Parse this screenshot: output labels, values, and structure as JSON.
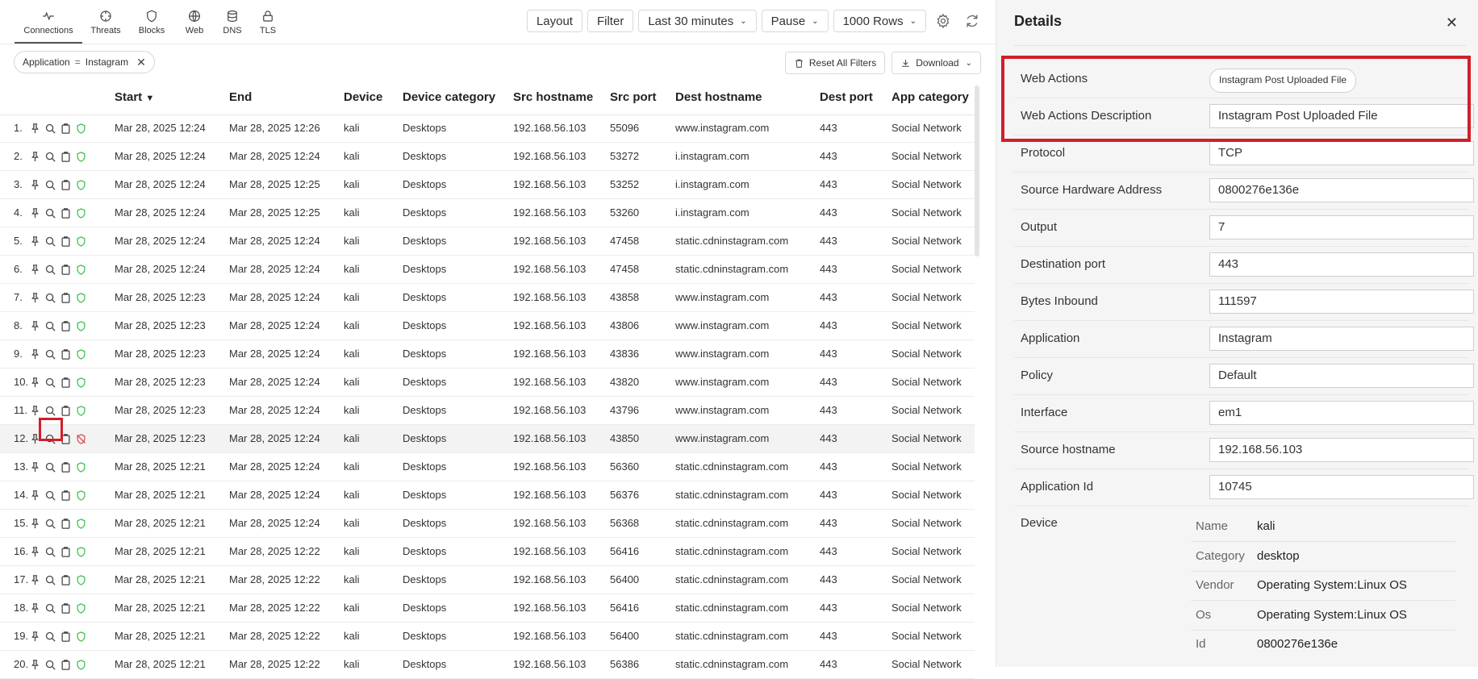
{
  "tabs": [
    {
      "label": "Connections",
      "icon": "pulse-icon"
    },
    {
      "label": "Threats",
      "icon": "crosshair-icon"
    },
    {
      "label": "Blocks",
      "icon": "shield-icon"
    },
    {
      "label": "Web",
      "icon": "globe-icon"
    },
    {
      "label": "DNS",
      "icon": "database-icon"
    },
    {
      "label": "TLS",
      "icon": "lock-icon"
    }
  ],
  "toolbar": {
    "layout": "Layout",
    "filter": "Filter",
    "range": "Last 30 minutes",
    "pause": "Pause",
    "rows": "1000 Rows"
  },
  "filter_chip": {
    "field": "Application",
    "op": "=",
    "value": "Instagram"
  },
  "actions": {
    "reset": "Reset All Filters",
    "download": "Download"
  },
  "columns": [
    "Start",
    "End",
    "Device",
    "Device category",
    "Src hostname",
    "Src port",
    "Dest hostname",
    "Dest port",
    "App category"
  ],
  "rows": [
    {
      "n": "1.",
      "start": "Mar 28, 2025 12:24",
      "end": "Mar 28, 2025 12:26",
      "device": "kali",
      "cat": "Desktops",
      "src": "192.168.56.103",
      "sport": "55096",
      "dest": "www.instagram.com",
      "dport": "443",
      "app": "Social Network"
    },
    {
      "n": "2.",
      "start": "Mar 28, 2025 12:24",
      "end": "Mar 28, 2025 12:24",
      "device": "kali",
      "cat": "Desktops",
      "src": "192.168.56.103",
      "sport": "53272",
      "dest": "i.instagram.com",
      "dport": "443",
      "app": "Social Network"
    },
    {
      "n": "3.",
      "start": "Mar 28, 2025 12:24",
      "end": "Mar 28, 2025 12:25",
      "device": "kali",
      "cat": "Desktops",
      "src": "192.168.56.103",
      "sport": "53252",
      "dest": "i.instagram.com",
      "dport": "443",
      "app": "Social Network"
    },
    {
      "n": "4.",
      "start": "Mar 28, 2025 12:24",
      "end": "Mar 28, 2025 12:25",
      "device": "kali",
      "cat": "Desktops",
      "src": "192.168.56.103",
      "sport": "53260",
      "dest": "i.instagram.com",
      "dport": "443",
      "app": "Social Network"
    },
    {
      "n": "5.",
      "start": "Mar 28, 2025 12:24",
      "end": "Mar 28, 2025 12:24",
      "device": "kali",
      "cat": "Desktops",
      "src": "192.168.56.103",
      "sport": "47458",
      "dest": "static.cdninstagram.com",
      "dport": "443",
      "app": "Social Network"
    },
    {
      "n": "6.",
      "start": "Mar 28, 2025 12:24",
      "end": "Mar 28, 2025 12:24",
      "device": "kali",
      "cat": "Desktops",
      "src": "192.168.56.103",
      "sport": "47458",
      "dest": "static.cdninstagram.com",
      "dport": "443",
      "app": "Social Network"
    },
    {
      "n": "7.",
      "start": "Mar 28, 2025 12:23",
      "end": "Mar 28, 2025 12:24",
      "device": "kali",
      "cat": "Desktops",
      "src": "192.168.56.103",
      "sport": "43858",
      "dest": "www.instagram.com",
      "dport": "443",
      "app": "Social Network"
    },
    {
      "n": "8.",
      "start": "Mar 28, 2025 12:23",
      "end": "Mar 28, 2025 12:24",
      "device": "kali",
      "cat": "Desktops",
      "src": "192.168.56.103",
      "sport": "43806",
      "dest": "www.instagram.com",
      "dport": "443",
      "app": "Social Network"
    },
    {
      "n": "9.",
      "start": "Mar 28, 2025 12:23",
      "end": "Mar 28, 2025 12:24",
      "device": "kali",
      "cat": "Desktops",
      "src": "192.168.56.103",
      "sport": "43836",
      "dest": "www.instagram.com",
      "dport": "443",
      "app": "Social Network"
    },
    {
      "n": "10.",
      "start": "Mar 28, 2025 12:23",
      "end": "Mar 28, 2025 12:24",
      "device": "kali",
      "cat": "Desktops",
      "src": "192.168.56.103",
      "sport": "43820",
      "dest": "www.instagram.com",
      "dport": "443",
      "app": "Social Network"
    },
    {
      "n": "11.",
      "start": "Mar 28, 2025 12:23",
      "end": "Mar 28, 2025 12:24",
      "device": "kali",
      "cat": "Desktops",
      "src": "192.168.56.103",
      "sport": "43796",
      "dest": "www.instagram.com",
      "dport": "443",
      "app": "Social Network"
    },
    {
      "n": "12.",
      "start": "Mar 28, 2025 12:23",
      "end": "Mar 28, 2025 12:24",
      "device": "kali",
      "cat": "Desktops",
      "src": "192.168.56.103",
      "sport": "43850",
      "dest": "www.instagram.com",
      "dport": "443",
      "app": "Social Network"
    },
    {
      "n": "13.",
      "start": "Mar 28, 2025 12:21",
      "end": "Mar 28, 2025 12:24",
      "device": "kali",
      "cat": "Desktops",
      "src": "192.168.56.103",
      "sport": "56360",
      "dest": "static.cdninstagram.com",
      "dport": "443",
      "app": "Social Network"
    },
    {
      "n": "14.",
      "start": "Mar 28, 2025 12:21",
      "end": "Mar 28, 2025 12:24",
      "device": "kali",
      "cat": "Desktops",
      "src": "192.168.56.103",
      "sport": "56376",
      "dest": "static.cdninstagram.com",
      "dport": "443",
      "app": "Social Network"
    },
    {
      "n": "15.",
      "start": "Mar 28, 2025 12:21",
      "end": "Mar 28, 2025 12:24",
      "device": "kali",
      "cat": "Desktops",
      "src": "192.168.56.103",
      "sport": "56368",
      "dest": "static.cdninstagram.com",
      "dport": "443",
      "app": "Social Network"
    },
    {
      "n": "16.",
      "start": "Mar 28, 2025 12:21",
      "end": "Mar 28, 2025 12:22",
      "device": "kali",
      "cat": "Desktops",
      "src": "192.168.56.103",
      "sport": "56416",
      "dest": "static.cdninstagram.com",
      "dport": "443",
      "app": "Social Network"
    },
    {
      "n": "17.",
      "start": "Mar 28, 2025 12:21",
      "end": "Mar 28, 2025 12:22",
      "device": "kali",
      "cat": "Desktops",
      "src": "192.168.56.103",
      "sport": "56400",
      "dest": "static.cdninstagram.com",
      "dport": "443",
      "app": "Social Network"
    },
    {
      "n": "18.",
      "start": "Mar 28, 2025 12:21",
      "end": "Mar 28, 2025 12:22",
      "device": "kali",
      "cat": "Desktops",
      "src": "192.168.56.103",
      "sport": "56416",
      "dest": "static.cdninstagram.com",
      "dport": "443",
      "app": "Social Network"
    },
    {
      "n": "19.",
      "start": "Mar 28, 2025 12:21",
      "end": "Mar 28, 2025 12:22",
      "device": "kali",
      "cat": "Desktops",
      "src": "192.168.56.103",
      "sport": "56400",
      "dest": "static.cdninstagram.com",
      "dport": "443",
      "app": "Social Network"
    },
    {
      "n": "20.",
      "start": "Mar 28, 2025 12:21",
      "end": "Mar 28, 2025 12:22",
      "device": "kali",
      "cat": "Desktops",
      "src": "192.168.56.103",
      "sport": "56386",
      "dest": "static.cdninstagram.com",
      "dport": "443",
      "app": "Social Network"
    }
  ],
  "details": {
    "title": "Details",
    "web_actions_label": "Web Actions",
    "web_actions_value": "Instagram Post Uploaded File",
    "fields": [
      {
        "label": "Web Actions Description",
        "value": "Instagram Post Uploaded File"
      },
      {
        "label": "Protocol",
        "value": "TCP"
      },
      {
        "label": "Source Hardware Address",
        "value": "0800276e136e"
      },
      {
        "label": "Output",
        "value": "7"
      },
      {
        "label": "Destination port",
        "value": "443"
      },
      {
        "label": "Bytes Inbound",
        "value": "111597"
      },
      {
        "label": "Application",
        "value": "Instagram"
      },
      {
        "label": "Policy",
        "value": "Default"
      },
      {
        "label": "Interface",
        "value": "em1"
      },
      {
        "label": "Source hostname",
        "value": "192.168.56.103"
      },
      {
        "label": "Application Id",
        "value": "10745"
      }
    ],
    "device_label": "Device",
    "device": [
      {
        "label": "Name",
        "value": "kali"
      },
      {
        "label": "Category",
        "value": "desktop"
      },
      {
        "label": "Vendor",
        "value": "Operating System:Linux OS"
      },
      {
        "label": "Os",
        "value": "Operating System:Linux OS"
      },
      {
        "label": "Id",
        "value": "0800276e136e"
      }
    ]
  },
  "colors": {
    "highlight": "#d01f2a",
    "shield": "#3cbf4a",
    "shield_off": "#d94c58"
  }
}
